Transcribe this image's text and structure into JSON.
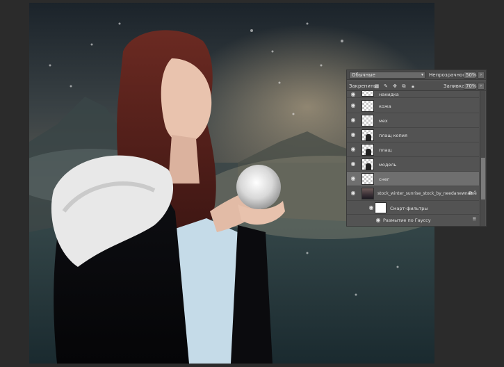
{
  "layers_panel": {
    "blend_mode": "Обычные",
    "opacity_label": "Непрозрачность:",
    "opacity_value": "50%",
    "lock_label": "Закрепить:",
    "fill_label": "Заливка:",
    "fill_value": "70%",
    "layers": [
      {
        "name": "накидка",
        "thumb": "transparent",
        "visible": true
      },
      {
        "name": "кожа",
        "thumb": "transparent",
        "visible": true
      },
      {
        "name": "мех",
        "thumb": "transparent",
        "visible": true
      },
      {
        "name": "плащ копия",
        "thumb": "figure",
        "visible": true
      },
      {
        "name": "плащ",
        "thumb": "figure",
        "visible": true
      },
      {
        "name": "модель",
        "thumb": "figure",
        "visible": true
      },
      {
        "name": "снег",
        "thumb": "transparent",
        "visible": true,
        "selected": true
      },
      {
        "name": "stock_winter_sunrise_stock_by_needanewname",
        "thumb": "photo",
        "visible": true,
        "smart_object": true
      }
    ],
    "smart_filters_label": "Смарт-фильтры",
    "filter_name": "Размытие по Гауссу"
  },
  "icons": {
    "eye": "eye-icon",
    "lock_pixels": "lock-transparent-pixels-icon",
    "lock_brush": "lock-image-pixels-icon",
    "lock_move": "lock-position-icon",
    "lock_artboard": "lock-artboard-icon",
    "lock_all": "lock-all-icon",
    "smart_object": "smart-object-icon",
    "filter_settings": "filter-blending-options-icon",
    "dropdown": "chevron-down-icon"
  },
  "colors": {
    "panel_bg": "#535353",
    "selected_row": "#6f6f6f",
    "workspace_bg": "#2b2b2b"
  }
}
